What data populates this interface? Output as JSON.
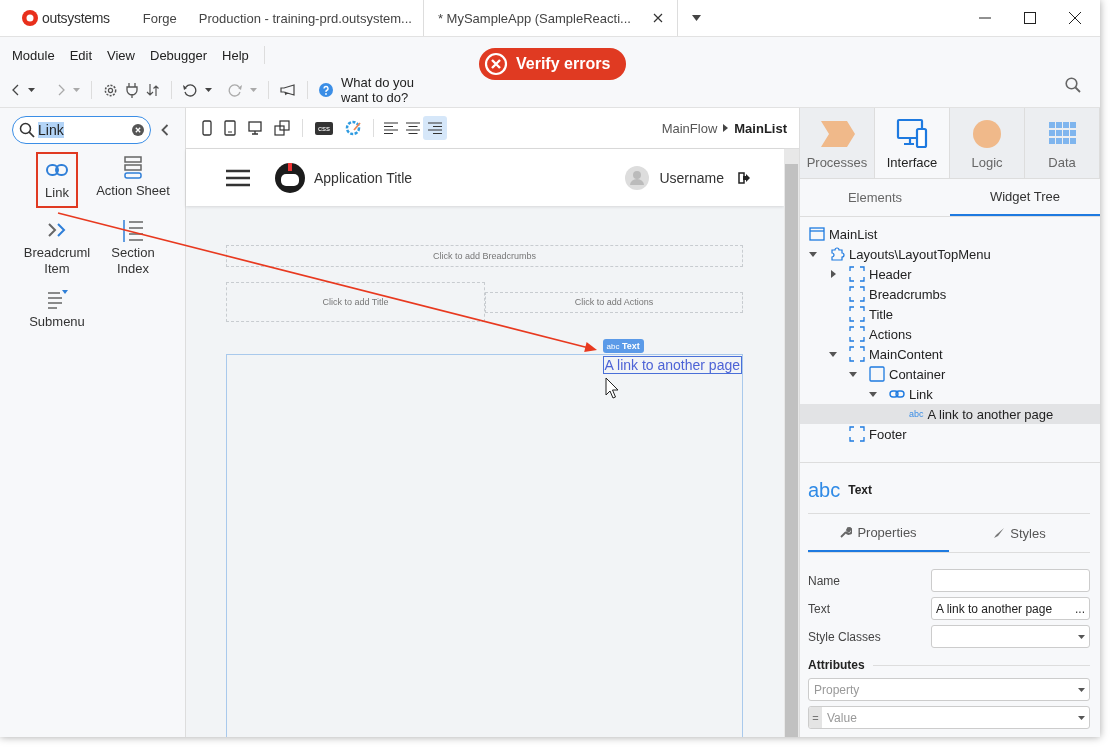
{
  "title_bar": {
    "logo": "outsystems",
    "tabs": [
      {
        "label": "Forge",
        "selected": false
      },
      {
        "label": "Production - training-prd.outsystem...",
        "selected": false
      },
      {
        "label": "* MySampleApp (SampleReacti...",
        "selected": true
      }
    ]
  },
  "menu": [
    "Module",
    "Edit",
    "View",
    "Debugger",
    "Help"
  ],
  "toolbar": {
    "help_text": "What do you want to do?",
    "verify_button": "Verify errors"
  },
  "widget_search": {
    "value": "Link"
  },
  "widgets": [
    {
      "label": "Link",
      "kind": "link",
      "selected": true
    },
    {
      "label": "Action Sheet",
      "kind": "action-sheet",
      "selected": false
    },
    {
      "label": "Breadcruml Item",
      "kind": "breadcrumb",
      "selected": false
    },
    {
      "label": "Section Index",
      "kind": "section-index",
      "selected": false
    },
    {
      "label": "Submenu",
      "kind": "submenu",
      "selected": false
    }
  ],
  "canvas_toolbar": {
    "css_label": "css",
    "alignment_buttons": [
      {
        "kind": "left",
        "selected": false
      },
      {
        "kind": "center",
        "selected": false
      },
      {
        "kind": "right",
        "selected": true
      }
    ],
    "breadcrumb": [
      "MainFlow",
      "MainList"
    ]
  },
  "canvas": {
    "app_title": "Application Title",
    "username": "Username",
    "placeholders": [
      "Click to add Breadcrumbs",
      "Click to add Title",
      "Click to add Actions"
    ],
    "badge_icon": "abc",
    "badge": "Text",
    "link_text": "A link to another page"
  },
  "main_tabs": [
    {
      "label": "Processes",
      "kind": "processes",
      "selected": false
    },
    {
      "label": "Interface",
      "kind": "interface",
      "selected": true
    },
    {
      "label": "Logic",
      "kind": "logic",
      "selected": false
    },
    {
      "label": "Data",
      "kind": "data",
      "selected": false
    }
  ],
  "sub_tabs": [
    {
      "label": "Elements",
      "selected": false
    },
    {
      "label": "Widget Tree",
      "selected": true
    }
  ],
  "tree": [
    {
      "label": "MainList",
      "kind": "screen",
      "selected": false
    },
    {
      "label": "Layouts\\LayoutTopMenu",
      "kind": "block",
      "expanded": true,
      "selected": false,
      "children": [
        {
          "label": "Header",
          "kind": "placeholder",
          "expanded": false,
          "selected": false
        },
        {
          "label": "Breadcrumbs",
          "kind": "placeholder",
          "selected": false
        },
        {
          "label": "Title",
          "kind": "placeholder",
          "selected": false
        },
        {
          "label": "Actions",
          "kind": "placeholder",
          "selected": false
        },
        {
          "label": "MainContent",
          "kind": "placeholder",
          "expanded": true,
          "selected": false,
          "children": [
            {
              "label": "Container",
              "kind": "container",
              "expanded": true,
              "selected": false,
              "children": [
                {
                  "label": "Link",
                  "kind": "link",
                  "expanded": true,
                  "selected": false,
                  "children": [
                    {
                      "label": "A link to another page",
                      "kind": "text",
                      "icon_text": "abc",
                      "selected": true
                    }
                  ]
                }
              ]
            }
          ]
        },
        {
          "label": "Footer",
          "kind": "placeholder",
          "selected": false
        }
      ]
    }
  ],
  "properties": {
    "icon_text": "abc",
    "title": "Text",
    "tabs": [
      {
        "label": "Properties",
        "kind": "wrench",
        "selected": true
      },
      {
        "label": "Styles",
        "kind": "brush",
        "selected": false
      }
    ],
    "fields": [
      {
        "label": "Name",
        "kind": "text"
      },
      {
        "label": "Text",
        "kind": "more",
        "value": "A link to another page",
        "more": "..."
      },
      {
        "label": "Style Classes",
        "kind": "select"
      }
    ],
    "attributes_heading": "Attributes",
    "attributes": [
      {
        "kind": "select",
        "placeholder": "Property"
      },
      {
        "kind": "prefixed",
        "prefix": "=",
        "placeholder": "Value"
      }
    ]
  }
}
